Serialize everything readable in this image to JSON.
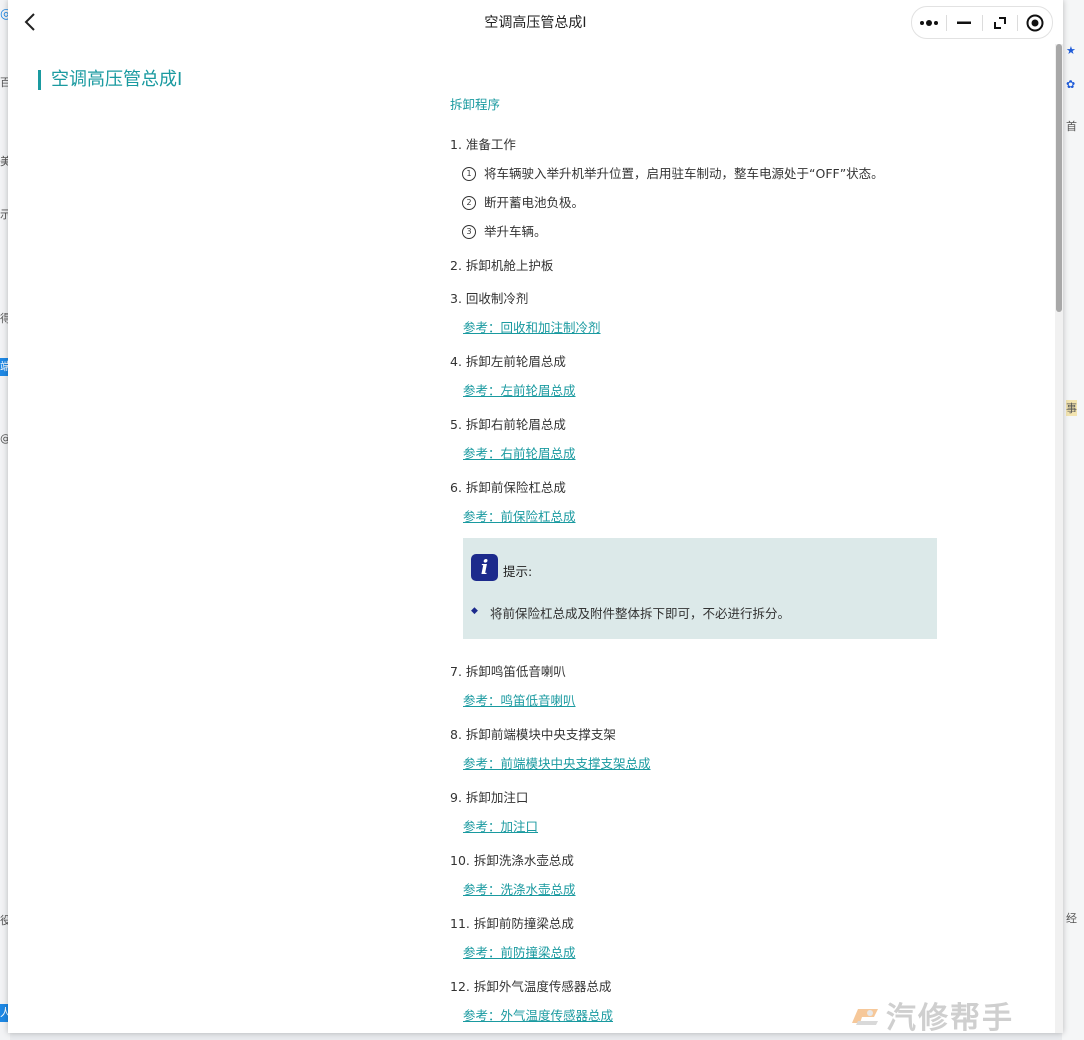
{
  "window": {
    "title": "空调高压管总成Ⅰ"
  },
  "capsule": {
    "more_icon": "more-dots-icon",
    "minimize_icon": "minimize-icon",
    "restore_icon": "restore-icon",
    "close_icon": "target-close-icon"
  },
  "page": {
    "heading": "空调高压管总成Ⅰ",
    "section_title": "拆卸程序",
    "steps": [
      {
        "num": "1.",
        "label": "准备工作",
        "subs": [
          {
            "n": "1",
            "text": "将车辆驶入举升机举升位置，启用驻车制动，整车电源处于“OFF”状态。"
          },
          {
            "n": "2",
            "text": "断开蓄电池负极。"
          },
          {
            "n": "3",
            "text": "举升车辆。"
          }
        ]
      },
      {
        "num": "2.",
        "label": "拆卸机舱上护板"
      },
      {
        "num": "3.",
        "label": "回收制冷剂",
        "ref": "参考：回收和加注制冷剂"
      },
      {
        "num": "4.",
        "label": "拆卸左前轮眉总成",
        "ref": "参考：左前轮眉总成"
      },
      {
        "num": "5.",
        "label": "拆卸右前轮眉总成",
        "ref": "参考：右前轮眉总成"
      },
      {
        "num": "6.",
        "label": "拆卸前保险杠总成",
        "ref": "参考：前保险杠总成"
      },
      {
        "num": "7.",
        "label": "拆卸鸣笛低音喇叭",
        "ref": "参考：鸣笛低音喇叭"
      },
      {
        "num": "8.",
        "label": "拆卸前端模块中央支撑支架",
        "ref": "参考：前端模块中央支撑支架总成"
      },
      {
        "num": "9.",
        "label": "拆卸加注口",
        "ref": "参考：加注口"
      },
      {
        "num": "10.",
        "label": "拆卸洗涤水壶总成",
        "ref": "参考：洗涤水壶总成"
      },
      {
        "num": "11.",
        "label": "拆卸前防撞梁总成",
        "ref": "参考：前防撞梁总成"
      },
      {
        "num": "12.",
        "label": "拆卸外气温度传感器总成",
        "ref": "参考：外气温度传感器总成"
      }
    ],
    "note": {
      "icon": "info-i-icon",
      "label": "提示:",
      "text": "将前保险杠总成及附件整体拆下即可，不必进行拆分。"
    }
  },
  "watermark": {
    "text": "汽修帮手"
  },
  "colors": {
    "accent": "#1a9aa0",
    "note_bg": "#dce9e9",
    "note_icon": "#1c2a8c"
  }
}
